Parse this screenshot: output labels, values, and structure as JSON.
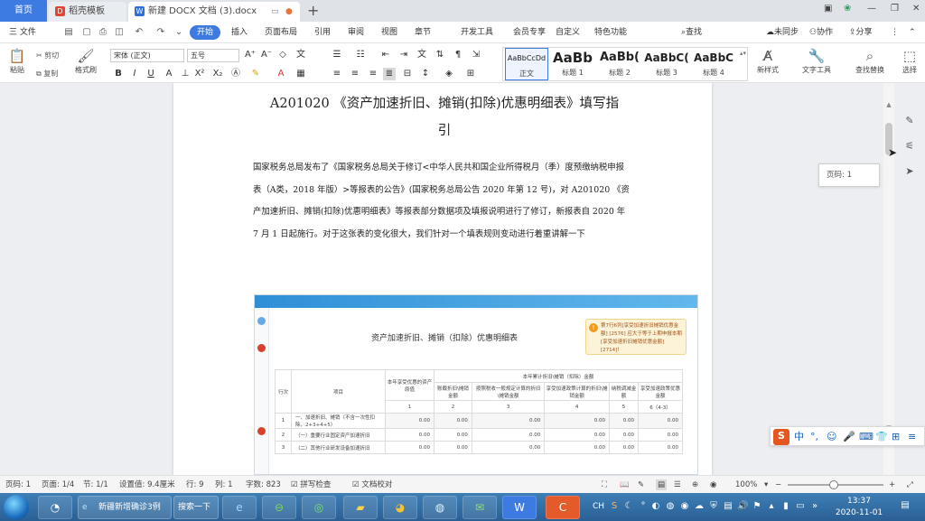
{
  "tabs": {
    "home": "首页",
    "template": "稻壳模板",
    "document": "新建 DOCX 文档 (3).docx",
    "doc_badge": "W"
  },
  "window": {
    "minimize": "—",
    "restore": "❐",
    "close": "✕"
  },
  "menu": {
    "file": "三 文件",
    "items": [
      "开始",
      "插入",
      "页面布局",
      "引用",
      "审阅",
      "视图",
      "章节",
      "开发工具",
      "会员专享",
      "自定义",
      "特色功能"
    ],
    "search": "查找",
    "right": [
      "未同步",
      "协作",
      "分享"
    ]
  },
  "ribbon": {
    "paste": "粘贴",
    "cut": "剪切",
    "copy": "复制",
    "format_painter": "格式刷",
    "font_name": "宋体 (正文)",
    "font_size": "五号",
    "styles": [
      {
        "preview": "AaBbCcDd",
        "label": "正文"
      },
      {
        "preview": "AaBb",
        "label": "标题 1"
      },
      {
        "preview": "AaBb(",
        "label": "标题 2"
      },
      {
        "preview": "AaBbC(",
        "label": "标题 3"
      },
      {
        "preview": "AaBbC",
        "label": "标题 4"
      }
    ],
    "new_style": "新样式",
    "text_tools": "文字工具",
    "find_replace": "查找替换",
    "select": "选择"
  },
  "document": {
    "title_line1": "A201020 《资产加速折旧、摊销(扣除)优惠明细表》填写指",
    "title_line2": "引",
    "paragraph": "国家税务总局发布了《国家税务总局关于修订<中华人民共和国企业所得税月（季）度预缴纳税申报表（A类，2018 年版）>等报表的公告》(国家税务总局公告 2020 年第 12 号)，对 A201020 《资产加速折旧、摊销(扣除)优惠明细表》等报表部分数据项及填报说明进行了修订，新报表自 2020 年 7 月 1 日起施行。对于这张表的变化很大，我们针对一个填表规则变动进行着重讲解一下"
  },
  "embedded_image": {
    "title": "资产加速折旧、摊销（扣除）优惠明细表",
    "alert": "第7行6列[享受加速折旧摊销优惠金额] [2576] 应大于等于上期申报本期[享受加速折旧摊销优惠金额] [2714]！",
    "header_group": "本年累计折旧\\摊销（扣除）金额",
    "headers": [
      "行次",
      "项目",
      "本年享受优惠的资产原值",
      "账载折旧\\摊销金额",
      "按照税收一般规定计算的折旧\\摊销金额",
      "享受加速政策计算的折旧\\摊销金额",
      "纳税调减金额",
      "享受加速政策优惠金额"
    ],
    "col_numbers": [
      "1",
      "2",
      "3",
      "4",
      "5",
      "6（4-3）"
    ],
    "rows": [
      {
        "line": "1",
        "item": "一、加速折旧、摊销（不含一次性扣除，2+3+4+5）",
        "values": [
          "0.00",
          "0.00",
          "0.00",
          "0.00",
          "0.00",
          "0.00"
        ]
      },
      {
        "line": "2",
        "item": "（一）重要行业固定资产加速折旧",
        "values": [
          "0.00",
          "0.00",
          "0.00",
          "0.00",
          "0.00",
          "0.00"
        ]
      },
      {
        "line": "3",
        "item": "（二）其他行业研发设备加速折旧",
        "values": [
          "0.00",
          "0.00",
          "0.00",
          "0.00",
          "0.00",
          "0.00"
        ]
      }
    ]
  },
  "side": {
    "page_tip": "页码: 1"
  },
  "ime": {
    "logo": "S",
    "mode": "中"
  },
  "status": {
    "page_num": "页码: 1",
    "pages": "页面: 1/4",
    "section": "节: 1/1",
    "setting": "设置值: 9.4厘米",
    "row": "行: 9",
    "col": "列: 1",
    "words": "字数: 823",
    "spell": "拼写检查",
    "proofread": "文档校对",
    "zoom": "100%"
  },
  "taskbar": {
    "window_label": "新疆新增确诊3例",
    "search_label": "搜索一下",
    "ime_lang": "CH",
    "time": "13:37",
    "date": "2020-11-01"
  }
}
